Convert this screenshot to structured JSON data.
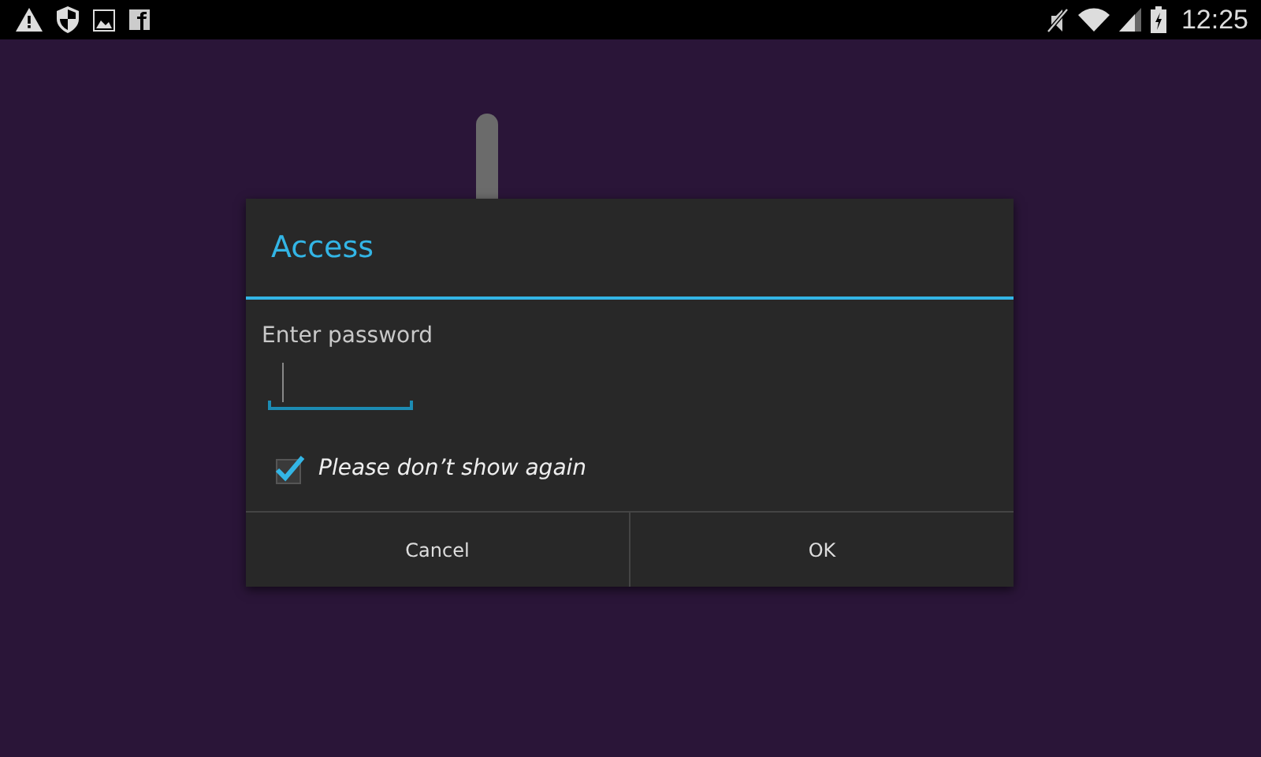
{
  "status_bar": {
    "time": "12:25"
  },
  "dialog": {
    "title": "Access",
    "prompt": "Enter password",
    "password_field": {
      "focused": true
    },
    "checkbox": {
      "label": "Please don’t show again",
      "checked": true
    },
    "buttons": [
      "Cancel",
      "OK"
    ]
  }
}
